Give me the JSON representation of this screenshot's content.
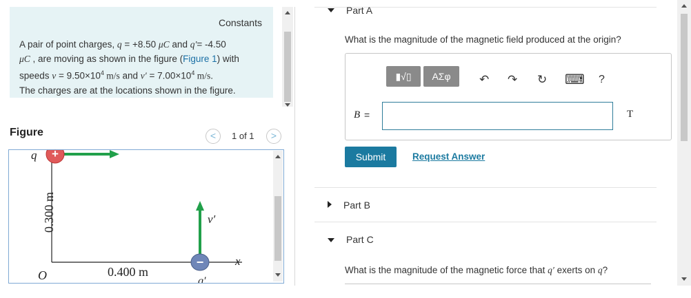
{
  "left": {
    "constants_label": "Constants",
    "problem": {
      "p1": "A pair of point charges, ",
      "q_sym": "q",
      "eq1": " = +8.50 ",
      "unit1": "μC",
      "and": " and ",
      "qp_sym": "q′",
      "eq2": "= -4.50",
      "unit2": "μC",
      "p2": " , are moving as shown in the figure (",
      "fig_link": "Figure 1",
      "p3": ") with",
      "speeds": "speeds ",
      "v_sym": "v",
      "eq3": " = 9.50×10",
      "exp1": "4",
      "unit3": " m/s",
      "and2": " and ",
      "vp_sym": "v′",
      "eq4": " = 7.00×10",
      "exp2": "4",
      "unit4": " m/s",
      "p4": ".",
      "p5": "The charges are at the locations shown in the figure."
    },
    "figure_label": "Figure",
    "pager_text": "1 of 1",
    "pager_prev": "<",
    "pager_next": ">",
    "figure": {
      "q_label": "q",
      "plus": "+",
      "minus": "−",
      "vprime_label": "v′",
      "x_label": "x",
      "y_dim": "0.300 m",
      "x_dim": "0.400 m",
      "origin": "O",
      "qprime_label": "q′"
    }
  },
  "right": {
    "partA_label": "Part A",
    "questionA": "What is the magnitude of the magnetic field produced at the origin?",
    "toolbar": {
      "templates": "▮√▯",
      "symbols": "ΑΣφ",
      "undo": "↶",
      "redo": "↷",
      "reset": "↻",
      "keyboard": "⌨",
      "help": "?"
    },
    "B_label": "B",
    "equals": "=",
    "unit": "T",
    "submit_label": "Submit",
    "request_label": "Request Answer",
    "partB_label": "Part B",
    "partC_label": "Part C",
    "questionC_pre": "What is the magnitude of the magnetic force that ",
    "questionC_qp": "q′",
    "questionC_mid": " exerts on ",
    "questionC_q": "q",
    "questionC_end": "?"
  },
  "colors": {
    "problem_bg": "#e6f3f5",
    "accent": "#1b7aa0",
    "positive_charge": "#e05a5a",
    "negative_charge": "#6f86b8",
    "velocity_arrow": "#21a04a"
  }
}
